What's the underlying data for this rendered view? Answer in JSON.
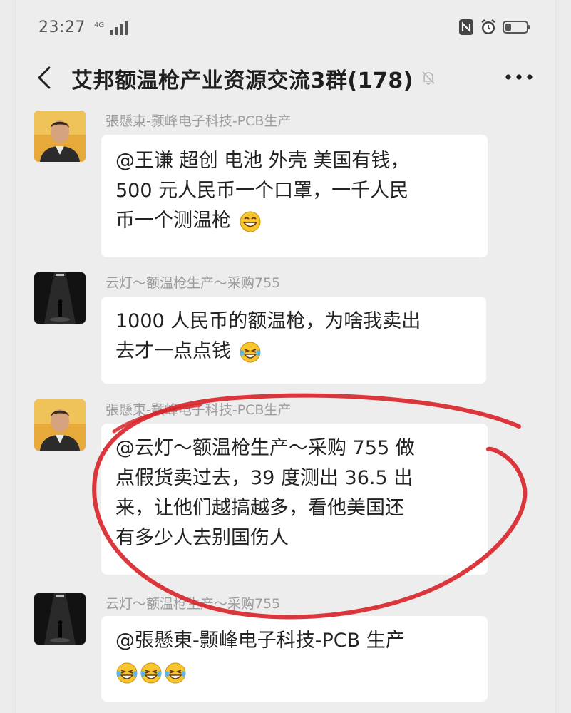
{
  "status_bar": {
    "time": "23:27",
    "signal_label": "4G"
  },
  "header": {
    "title": "艾邦额温枪产业资源交流3群(178)"
  },
  "messages": [
    {
      "sender": "張懸東-颢峰电子科技-PCB生产",
      "avatar": "man-portrait",
      "lines": [
        "@王谦 超创 电池 外壳  美国有钱，",
        "500 元人民币一个口罩，一千人民",
        "币一个测温枪"
      ],
      "emoji": [
        "grin-emoji"
      ]
    },
    {
      "sender": "云灯～额温枪生产～采购755",
      "avatar": "dark-stage-figure",
      "lines": [
        "1000 人民币的额温枪，为啥我卖出",
        "去才一点点钱"
      ],
      "emoji": [
        "laugh-cry-emoji"
      ]
    },
    {
      "sender": "張懸東-颢峰电子科技-PCB生产",
      "avatar": "man-portrait",
      "lines": [
        "@云灯～额温枪生产～采购 755  做",
        "点假货卖过去，39 度测出 36.5 出",
        "来，让他们越搞越多，看他美国还",
        "有多少人去别国伤人"
      ],
      "emoji": []
    },
    {
      "sender": "云灯～额温枪生产～采购755",
      "avatar": "dark-stage-figure",
      "lines": [
        "@張懸東-颢峰电子科技-PCB 生产"
      ],
      "emoji": [
        "laugh-cry-emoji",
        "laugh-cry-emoji",
        "laugh-cry-emoji"
      ]
    }
  ],
  "colors": {
    "background": "#ededed",
    "bubble": "#ffffff",
    "sender_text": "#9c9c9c",
    "annotation_circle": "#d8262c"
  }
}
